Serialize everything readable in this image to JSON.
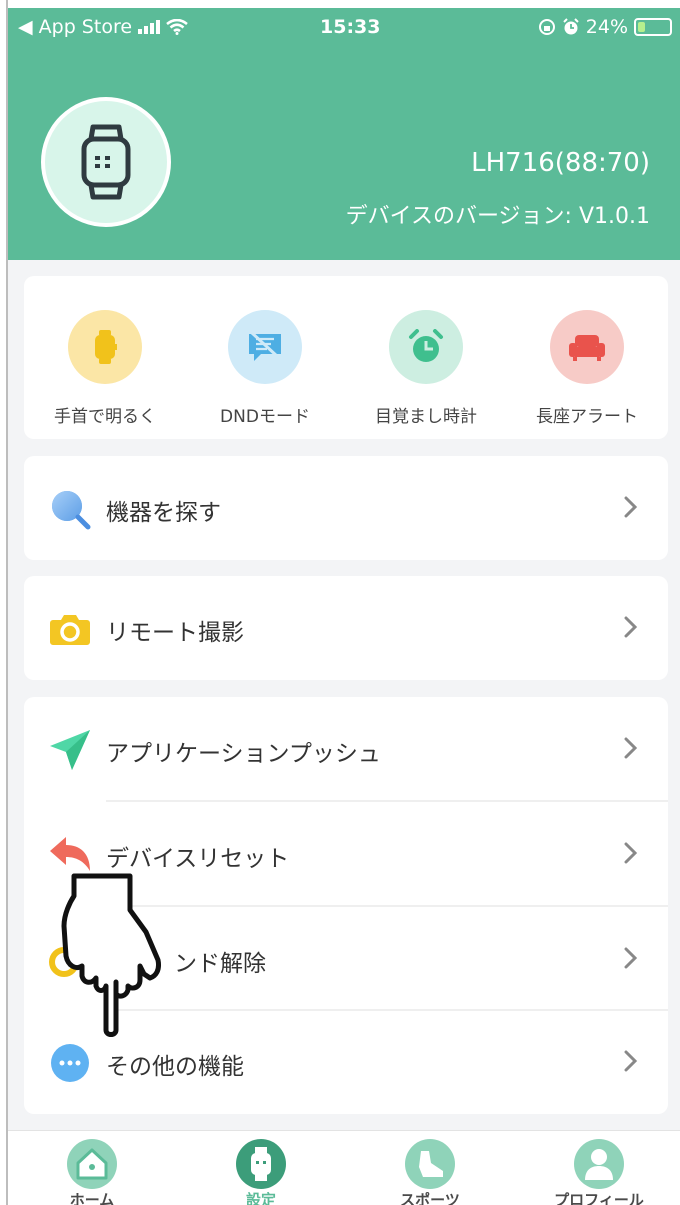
{
  "status_bar": {
    "back_app": "◀ App Store",
    "time": "15:33",
    "battery_percent": "24%",
    "battery_level": 0.24
  },
  "device": {
    "name": "LH716(88:70)",
    "version": "デバイスのバージョン: V1.0.1"
  },
  "quick_actions": [
    {
      "label": "手首で明るく",
      "icon": "watch-icon",
      "color": "#fbe6a6"
    },
    {
      "label": "DNDモード",
      "icon": "no-message-icon",
      "color": "#cfeaf8"
    },
    {
      "label": "目覚まし時計",
      "icon": "alarm-clock-icon",
      "color": "#cdeee1"
    },
    {
      "label": "長座アラート",
      "icon": "sofa-icon",
      "color": "#f7cbc7"
    }
  ],
  "menu": {
    "find_device": "機器を探す",
    "remote_camera": "リモート撮影",
    "app_push": "アプリケーションプッシュ",
    "device_reset": "デバイスリセット",
    "unbind": "ンド解除",
    "other_features": "その他の機能"
  },
  "tabs": [
    {
      "label": "ホーム",
      "icon": "home-icon"
    },
    {
      "label": "設定",
      "icon": "watch-settings-icon",
      "active": true
    },
    {
      "label": "スポーツ",
      "icon": "shoe-icon"
    },
    {
      "label": "プロフィール",
      "icon": "person-icon"
    }
  ],
  "colors": {
    "brand_green": "#5bbb98",
    "card_bg": "#ffffff",
    "page_bg": "#f3f4f6"
  }
}
